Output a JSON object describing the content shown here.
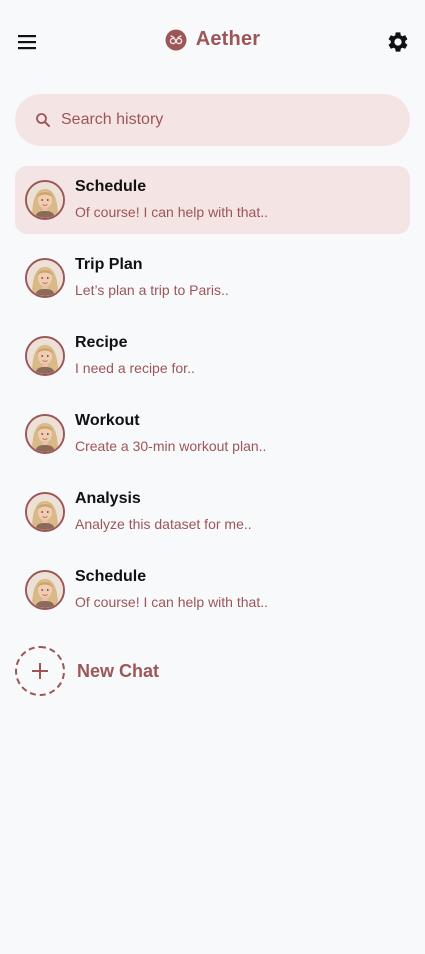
{
  "app": {
    "name": "Aether",
    "accent_color": "#9c5658",
    "highlight_color": "#f5e4e4",
    "background_color": "#f8f9fb"
  },
  "header": {
    "menu_icon": "hamburger-menu-icon",
    "logo_icon": "aether-logo-icon",
    "settings_icon": "gear-icon"
  },
  "search": {
    "icon": "search-icon",
    "placeholder": "Search history"
  },
  "history": [
    {
      "title": "Schedule",
      "preview": "Of course! I can help with that..",
      "selected": true
    },
    {
      "title": "Trip Plan",
      "preview": "Let’s plan a trip to Paris..",
      "selected": false
    },
    {
      "title": "Recipe",
      "preview": "I need a recipe for..",
      "selected": false
    },
    {
      "title": "Workout",
      "preview": "Create a 30-min workout plan..",
      "selected": false
    },
    {
      "title": "Analysis",
      "preview": "Analyze this dataset for me..",
      "selected": false
    },
    {
      "title": "Schedule",
      "preview": "Of course! I can help with that..",
      "selected": false
    }
  ],
  "new_chat": {
    "icon": "plus-icon",
    "label": "New Chat"
  }
}
